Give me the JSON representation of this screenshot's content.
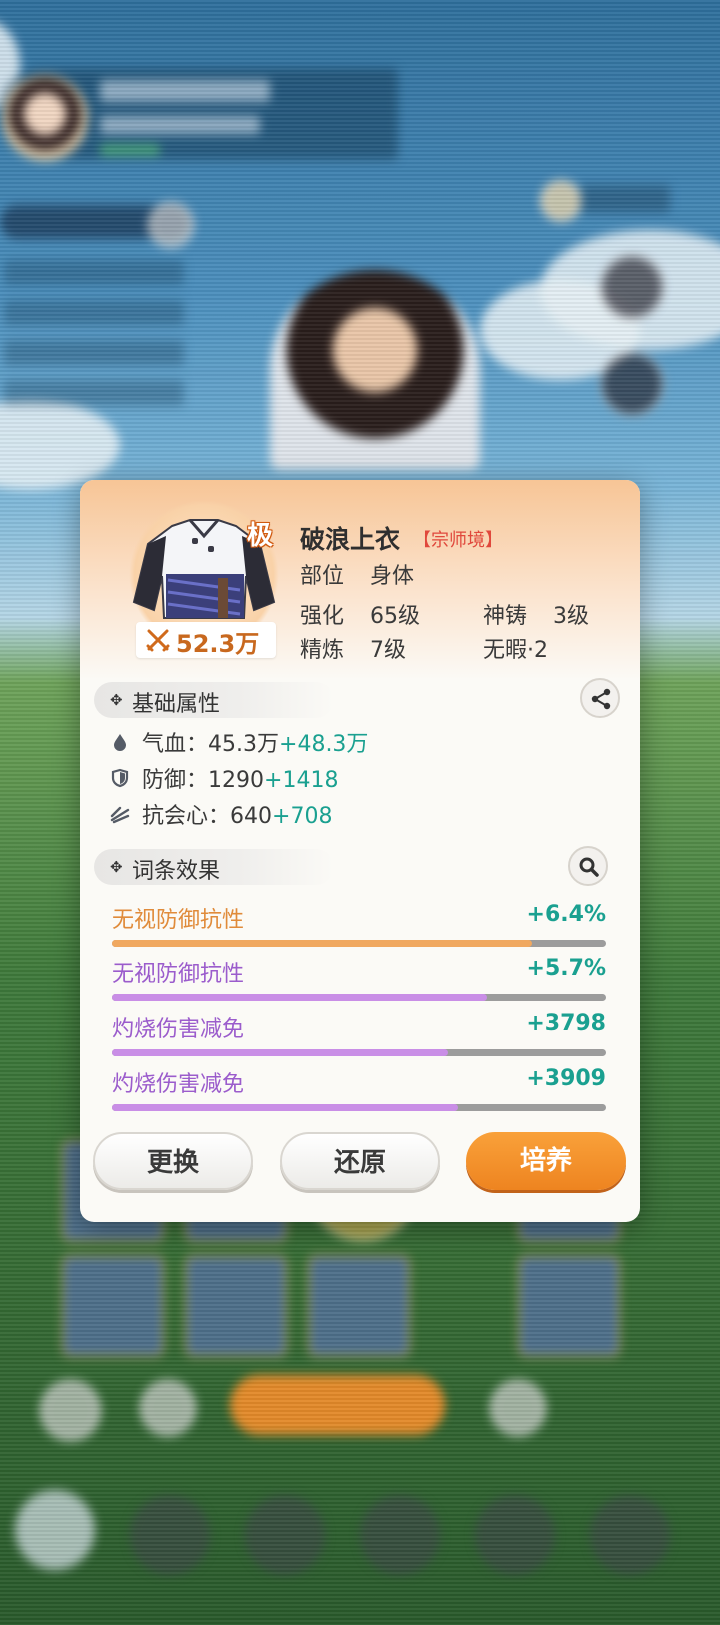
{
  "item": {
    "grade_badge": "极",
    "name": "破浪上衣",
    "realm": "【宗师境】",
    "power": "52.3万",
    "slot_label": "部位",
    "slot_value": "身体",
    "enhance_label": "强化",
    "enhance_value": "65级",
    "forge_label": "神铸",
    "forge_value": "3级",
    "refine_label": "精炼",
    "refine_value": "7级",
    "flawless": "无暇·2"
  },
  "base_section": {
    "title": "基础属性",
    "stats": [
      {
        "label": "气血：",
        "base": "45.3万",
        "bonus": "+48.3万",
        "icon": "drop-icon"
      },
      {
        "label": "防御：",
        "base": "1290",
        "bonus": "+1418",
        "icon": "shield-icon"
      },
      {
        "label": "抗会心：",
        "base": "640",
        "bonus": "+708",
        "icon": "anti-crit-icon"
      }
    ]
  },
  "affix_section": {
    "title": "词条效果",
    "affixes": [
      {
        "name": "无视防御抗性",
        "value": "+6.4%",
        "progress": 0.85,
        "color": "#f0a860"
      },
      {
        "name": "无视防御抗性",
        "value": "+5.7%",
        "progress": 0.76,
        "color": "#c98ee6"
      },
      {
        "name": "灼烧伤害减免",
        "value": "+3798",
        "progress": 0.68,
        "color": "#c98ee6"
      },
      {
        "name": "灼烧伤害减免",
        "value": "+3909",
        "progress": 0.7,
        "color": "#c98ee6"
      }
    ]
  },
  "actions": {
    "replace": "更换",
    "restore": "还原",
    "cultivate": "培养"
  },
  "colors": {
    "accent_orange": "#ee8420",
    "bonus_teal": "#1aa090",
    "affix_orange": "#e08b3a",
    "affix_purple": "#9b5ccc",
    "realm_red": "#e0483c"
  }
}
